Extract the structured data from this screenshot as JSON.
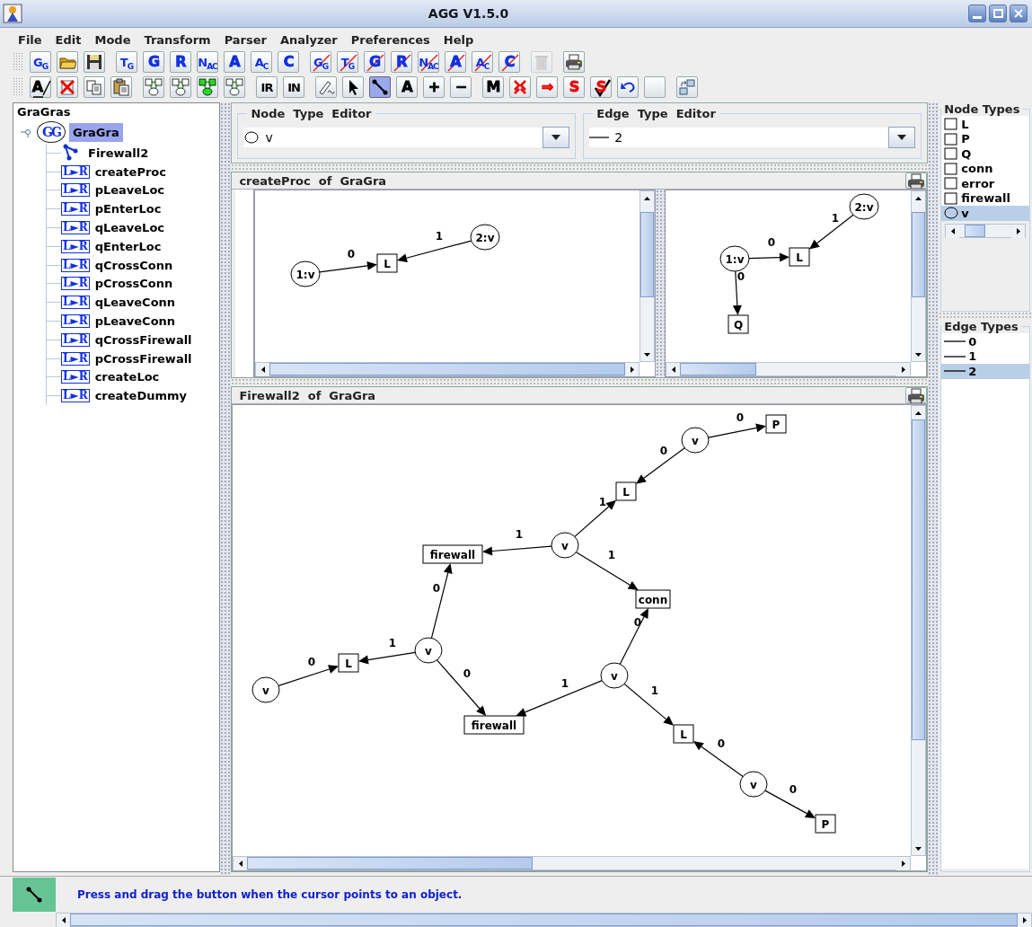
{
  "window": {
    "title": "AGG  V1.5.0"
  },
  "menu": [
    {
      "label": "File"
    },
    {
      "label": "Edit"
    },
    {
      "label": "Mode"
    },
    {
      "label": "Transform"
    },
    {
      "label": "Parser"
    },
    {
      "label": "Analyzer"
    },
    {
      "label": "Preferences"
    },
    {
      "label": "Help"
    }
  ],
  "toolbar_1": [
    [
      {
        "kind": "text",
        "label": "G$_{G}$",
        "color": "#1030e0",
        "crossed": false,
        "disabled": false
      },
      {
        "kind": "folder",
        "disabled": false
      },
      {
        "kind": "disk",
        "disabled": false
      }
    ],
    [
      {
        "kind": "text",
        "label": "T$_{G}$",
        "color": "#1030e0",
        "crossed": false,
        "disabled": false
      },
      {
        "kind": "text",
        "label": "G",
        "color": "#1030e0",
        "crossed": false,
        "disabled": false
      },
      {
        "kind": "text",
        "label": "R",
        "color": "#1030e0",
        "crossed": false,
        "disabled": false
      },
      {
        "kind": "text",
        "label": "N$_{AC}$",
        "color": "#1030e0",
        "crossed": false,
        "disabled": false
      },
      {
        "kind": "text",
        "label": "A",
        "color": "#1030e0",
        "crossed": false,
        "disabled": false
      },
      {
        "kind": "text",
        "label": "A$_{C}$",
        "color": "#1030e0",
        "crossed": false,
        "disabled": false
      },
      {
        "kind": "text",
        "label": "C",
        "color": "#1030e0",
        "crossed": false,
        "disabled": false
      }
    ],
    [
      {
        "kind": "text",
        "label": "G$_{G}$",
        "color": "#1030e0",
        "crossed": true,
        "disabled": false
      },
      {
        "kind": "text",
        "label": "T$_{G}$",
        "color": "#1030e0",
        "crossed": true,
        "disabled": false
      },
      {
        "kind": "text",
        "label": "G",
        "color": "#1030e0",
        "crossed": true,
        "disabled": false
      },
      {
        "kind": "text",
        "label": "R",
        "color": "#1030e0",
        "crossed": true,
        "disabled": false
      },
      {
        "kind": "text",
        "label": "N$_{AC}$",
        "color": "#1030e0",
        "crossed": true,
        "disabled": false
      },
      {
        "kind": "text",
        "label": "A",
        "color": "#1030e0",
        "crossed": true,
        "disabled": false
      },
      {
        "kind": "text",
        "label": "A$_{C}$",
        "color": "#1030e0",
        "crossed": true,
        "disabled": false
      },
      {
        "kind": "text",
        "label": "C",
        "color": "#1030e0",
        "crossed": true,
        "disabled": false
      }
    ],
    [
      {
        "kind": "trash",
        "disabled": true
      }
    ],
    [
      {
        "kind": "printer",
        "disabled": false
      }
    ]
  ],
  "toolbar_2": [
    [
      {
        "kind": "text",
        "label": "A",
        "color": "#000000",
        "crossed": true,
        "selected": false
      },
      {
        "kind": "delete",
        "selected": false
      },
      {
        "kind": "copy",
        "selected": false
      },
      {
        "kind": "paste",
        "selected": false
      }
    ],
    [
      {
        "kind": "graph",
        "color": "#ffffff",
        "selected": false
      },
      {
        "kind": "graph",
        "color": "#ffffff",
        "selected": false
      },
      {
        "kind": "graph",
        "color": "#22dd22",
        "selected": false
      },
      {
        "kind": "graph",
        "color": "#ffffff",
        "selected": false
      }
    ],
    [
      {
        "kind": "text",
        "label": "IR",
        "color": "#000000",
        "crossed": false,
        "selected": false
      },
      {
        "kind": "text",
        "label": "IN",
        "color": "#000000",
        "crossed": false,
        "selected": false
      }
    ],
    [
      {
        "kind": "pen",
        "selected": false
      },
      {
        "kind": "pointer",
        "selected": false
      },
      {
        "kind": "edge",
        "selected": true
      },
      {
        "kind": "text",
        "label": "A",
        "color": "#000000",
        "crossed": false,
        "selected": false
      },
      {
        "kind": "text",
        "label": "+",
        "color": "#000000",
        "crossed": false,
        "selected": false
      },
      {
        "kind": "text",
        "label": "−",
        "color": "#000000",
        "crossed": false,
        "selected": false
      }
    ],
    [
      {
        "kind": "text",
        "label": "M",
        "color": "#000000",
        "crossed": false,
        "selected": false
      },
      {
        "kind": "match",
        "selected": false
      },
      {
        "kind": "text",
        "label": "⇒",
        "color": "#ee0000",
        "crossed": false,
        "selected": false
      },
      {
        "kind": "text",
        "label": "S",
        "color": "#ee0000",
        "crossed": false,
        "selected": false
      },
      {
        "kind": "checktext",
        "label": "S",
        "color": "#ee0000",
        "selected": false
      },
      {
        "kind": "undo",
        "selected": false
      },
      {
        "kind": "blank",
        "selected": false
      }
    ],
    [
      {
        "kind": "layout",
        "selected": false
      }
    ]
  ],
  "tree": {
    "title": "GraGras",
    "root": {
      "label": "GraGra",
      "badge": "GG",
      "selected": true,
      "expanded": true,
      "children": [
        {
          "kind": "graph",
          "label": "Firewall2"
        },
        {
          "kind": "rule",
          "badge": "L►R",
          "label": "createProc"
        },
        {
          "kind": "rule",
          "badge": "L►R",
          "label": "pLeaveLoc"
        },
        {
          "kind": "rule",
          "badge": "L►R",
          "label": "pEnterLoc"
        },
        {
          "kind": "rule",
          "badge": "L►R",
          "label": "qLeaveLoc"
        },
        {
          "kind": "rule",
          "badge": "L►R",
          "label": "qEnterLoc"
        },
        {
          "kind": "rule",
          "badge": "L►R",
          "label": "qCrossConn"
        },
        {
          "kind": "rule",
          "badge": "L►R",
          "label": "pCrossConn"
        },
        {
          "kind": "rule",
          "badge": "L►R",
          "label": "qLeaveConn"
        },
        {
          "kind": "rule",
          "badge": "L►R",
          "label": "pLeaveConn"
        },
        {
          "kind": "rule",
          "badge": "L►R",
          "label": "qCrossFirewall"
        },
        {
          "kind": "rule",
          "badge": "L►R",
          "label": "pCrossFirewall"
        },
        {
          "kind": "rule",
          "badge": "L►R",
          "label": "createLoc"
        },
        {
          "kind": "rule",
          "badge": "L►R",
          "label": "createDummy"
        }
      ]
    }
  },
  "node_type_editor": {
    "title": "Node  Type  Editor",
    "kind": "circle",
    "value": "v"
  },
  "edge_type_editor": {
    "title": "Edge  Type  Editor",
    "value": "2"
  },
  "rule_panel": {
    "title": "createProc  of  GraGra",
    "left": {
      "nodes": [
        {
          "label": "1:v",
          "kind": "circle"
        },
        {
          "label": "L",
          "kind": "box"
        },
        {
          "label": "2:v",
          "kind": "circle"
        }
      ],
      "edges": [
        {
          "label": "0"
        },
        {
          "label": "1"
        }
      ]
    },
    "right": {
      "nodes": [
        {
          "label": "1:v",
          "kind": "circle"
        },
        {
          "label": "L",
          "kind": "box"
        },
        {
          "label": "2:v",
          "kind": "circle"
        },
        {
          "label": "Q",
          "kind": "box"
        }
      ],
      "edges": [
        {
          "label": "0"
        },
        {
          "label": "1"
        },
        {
          "label": "0"
        }
      ]
    }
  },
  "graph_panel": {
    "title": "Firewall2  of  GraGra",
    "nodes": [
      {
        "label": "v",
        "kind": "circle"
      },
      {
        "label": "P",
        "kind": "box"
      },
      {
        "label": "L",
        "kind": "box"
      },
      {
        "label": "v",
        "kind": "circle"
      },
      {
        "label": "firewall",
        "kind": "box"
      },
      {
        "label": "conn",
        "kind": "box"
      },
      {
        "label": "v",
        "kind": "circle"
      },
      {
        "label": "L",
        "kind": "box"
      },
      {
        "label": "v",
        "kind": "circle"
      },
      {
        "label": "firewall",
        "kind": "box"
      },
      {
        "label": "v",
        "kind": "circle"
      },
      {
        "label": "L",
        "kind": "box"
      },
      {
        "label": "v",
        "kind": "circle"
      },
      {
        "label": "P",
        "kind": "box"
      }
    ],
    "edges": [
      {
        "label": "0"
      },
      {
        "label": "0"
      },
      {
        "label": "1"
      },
      {
        "label": "1"
      },
      {
        "label": "1"
      },
      {
        "label": "0"
      },
      {
        "label": "1"
      },
      {
        "label": "0"
      },
      {
        "label": "0"
      },
      {
        "label": "0"
      },
      {
        "label": "1"
      },
      {
        "label": "1"
      },
      {
        "label": "0"
      },
      {
        "label": "0"
      }
    ]
  },
  "node_types": {
    "title": "Node Types",
    "items": [
      {
        "kind": "box",
        "label": "L",
        "selected": false
      },
      {
        "kind": "box",
        "label": "P",
        "selected": false
      },
      {
        "kind": "box",
        "label": "Q",
        "selected": false
      },
      {
        "kind": "box",
        "label": "conn",
        "selected": false
      },
      {
        "kind": "box",
        "label": "error",
        "selected": false
      },
      {
        "kind": "box",
        "label": "firewall",
        "selected": false
      },
      {
        "kind": "circle",
        "label": "v",
        "selected": true
      }
    ]
  },
  "edge_types": {
    "title": "Edge Types",
    "items": [
      {
        "label": "0",
        "selected": false
      },
      {
        "label": "1",
        "selected": false
      },
      {
        "label": "2",
        "selected": true
      }
    ]
  },
  "status_bar": {
    "mode_icon": {
      "kind": "edge"
    },
    "message": "Press and drag the button when the cursor points to an object."
  }
}
